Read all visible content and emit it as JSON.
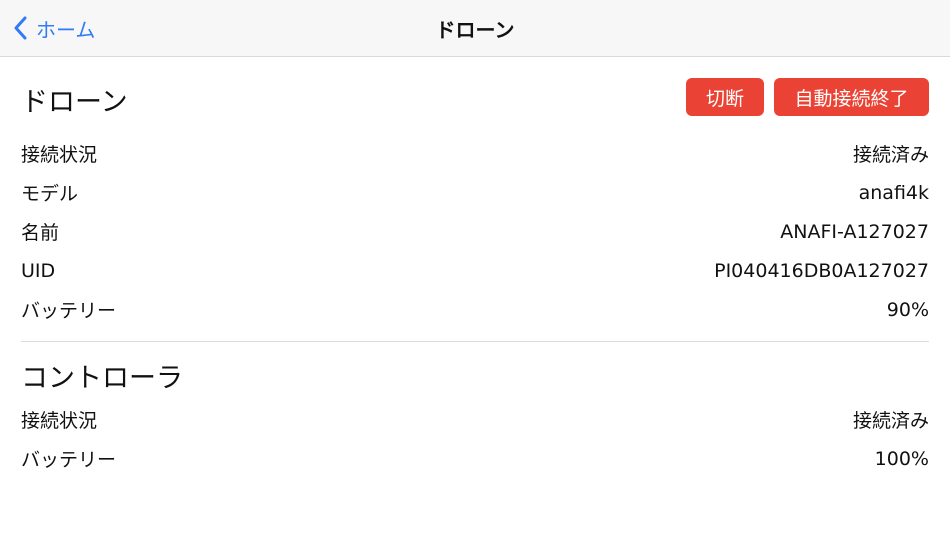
{
  "navbar": {
    "back_label": "ホーム",
    "title": "ドローン",
    "back_icon": "chevron-left-icon"
  },
  "drone": {
    "title": "ドローン",
    "buttons": {
      "disconnect": "切断",
      "auto_connect_end": "自動接続終了"
    },
    "rows": [
      {
        "label": "接続状況",
        "value": "接続済み"
      },
      {
        "label": "モデル",
        "value": "anafi4k"
      },
      {
        "label": "名前",
        "value": "ANAFI-A127027"
      },
      {
        "label": "UID",
        "value": "PI040416DB0A127027"
      },
      {
        "label": "バッテリー",
        "value": "90%"
      }
    ]
  },
  "controller": {
    "title": "コントローラ",
    "rows": [
      {
        "label": "接続状況",
        "value": "接続済み"
      },
      {
        "label": "バッテリー",
        "value": "100%"
      }
    ]
  },
  "colors": {
    "accent": "#2f7cf6",
    "danger": "#ea4335",
    "navbar_bg": "#f7f7f7"
  }
}
